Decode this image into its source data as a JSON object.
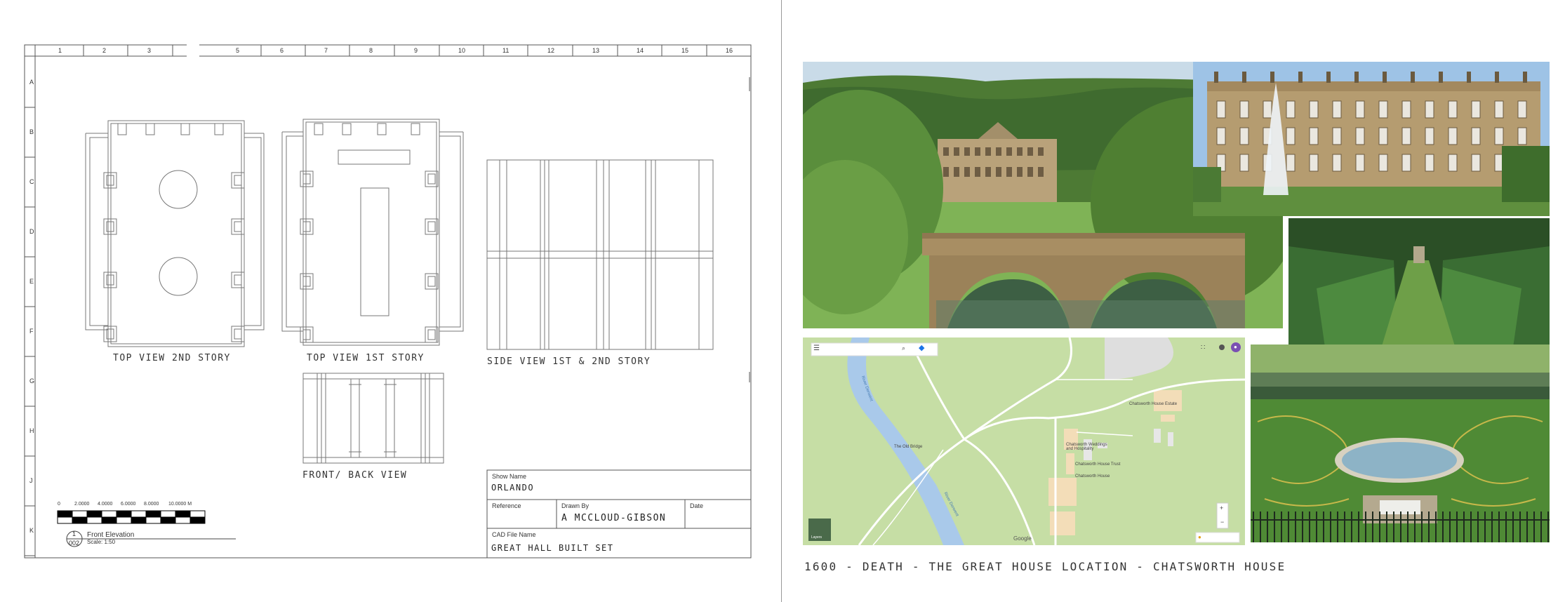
{
  "ruler": {
    "columns": [
      "1",
      "2",
      "3",
      "5",
      "6",
      "7",
      "8",
      "9",
      "10",
      "11",
      "12",
      "13",
      "14",
      "15",
      "16"
    ],
    "rows": [
      "A",
      "B",
      "C",
      "D",
      "E",
      "F",
      "G",
      "H",
      "J",
      "K"
    ]
  },
  "views": {
    "top_2nd": "TOP VIEW 2ND STORY",
    "top_1st": "TOP VIEW 1ST STORY",
    "side": "SIDE VIEW 1ST & 2ND STORY",
    "front_back": "FRONT/ BACK VIEW"
  },
  "scale_bar": {
    "ticks": [
      "0",
      "2.0000",
      "4.0000",
      "6.0000",
      "8.0000",
      "10.0000 M"
    ]
  },
  "elevation_tag": {
    "number": "1",
    "sheet": "002",
    "title": "Front Elevation",
    "scale": "Scale: 1:50"
  },
  "title_block": {
    "show_name_label": "Show Name",
    "show_name": "ORLANDO",
    "reference_label": "Reference",
    "drawn_by_label": "Drawn By",
    "drawn_by": "A MCCLOUD-GIBSON",
    "date_label": "Date",
    "cad_label": "CAD File Name",
    "cad_file": "GREAT HALL BUILT SET"
  },
  "map": {
    "places": [
      "Chatsworth House Estate",
      "Chatsworth Weddings and Hospitality",
      "Chatsworth House Trust",
      "Chatsworth House",
      "The Old Bridge",
      "River Derwent",
      "River Derwent"
    ],
    "google": "Google",
    "layers": "Layers"
  },
  "caption": "1600 - DEATH - THE GREAT HOUSE LOCATION - CHATSWORTH HOUSE",
  "colors": {
    "map_green": "#c6dea5",
    "river": "#a9c9ea",
    "line": "#555555",
    "foliage": "#3f6b2f",
    "sky": "#9ec3e6"
  },
  "icons": [
    "menu-icon",
    "search-icon",
    "directions-icon",
    "apps-icon",
    "account-icon",
    "zoom-in-icon",
    "zoom-out-icon",
    "pegman-icon"
  ]
}
